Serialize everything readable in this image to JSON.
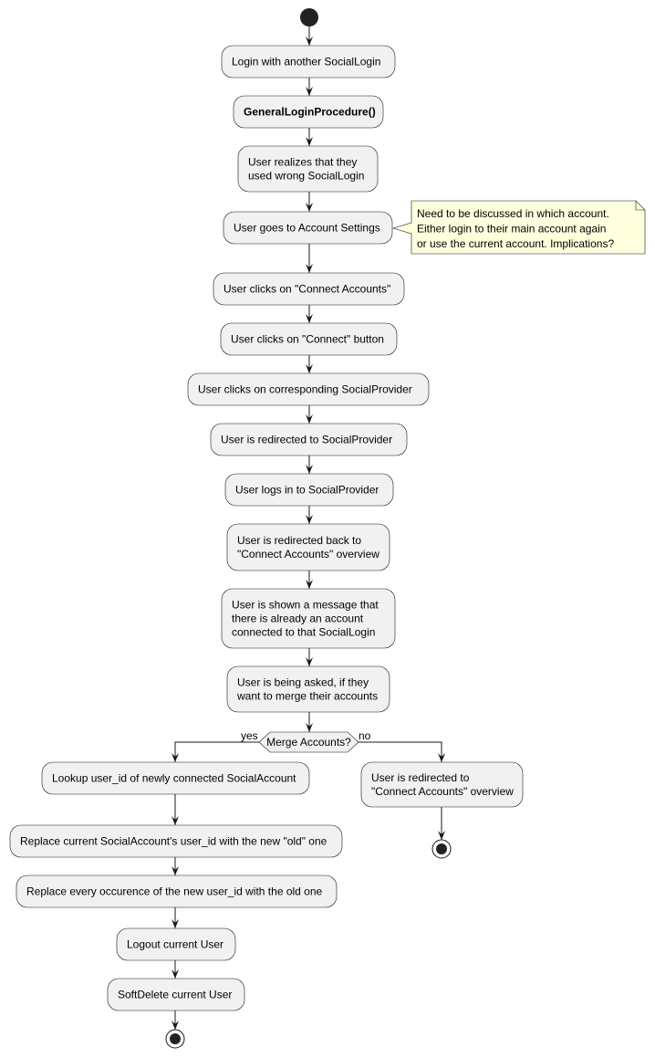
{
  "colors": {
    "node_fill": "#f1f1f1",
    "node_stroke": "#181818",
    "note_fill": "#feffdd",
    "line": "#181818",
    "start": "#222222"
  },
  "nodes": [
    {
      "id": "login-another",
      "lines": [
        "Login with another SocialLogin"
      ]
    },
    {
      "id": "general-login",
      "lines": [
        "GeneralLoginProcedure()"
      ],
      "bold": true
    },
    {
      "id": "realizes-wrong",
      "lines": [
        "User realizes that they",
        "used wrong SocialLogin"
      ]
    },
    {
      "id": "account-settings",
      "lines": [
        "User goes to Account Settings"
      ]
    },
    {
      "id": "click-connect-accounts",
      "lines": [
        "User clicks on \"Connect Accounts\""
      ]
    },
    {
      "id": "click-connect-button",
      "lines": [
        "User clicks on \"Connect\" button"
      ]
    },
    {
      "id": "click-provider",
      "lines": [
        "User clicks on corresponding SocialProvider"
      ]
    },
    {
      "id": "redirected-provider",
      "lines": [
        "User is redirected to SocialProvider"
      ]
    },
    {
      "id": "logs-in-provider",
      "lines": [
        "User logs in to SocialProvider"
      ]
    },
    {
      "id": "redirected-back",
      "lines": [
        "User is redirected back to",
        "\"Connect Accounts\" overview"
      ]
    },
    {
      "id": "shown-message",
      "lines": [
        "User is shown a message that",
        "there is already an account",
        "connected to that SocialLogin"
      ]
    },
    {
      "id": "asked-merge",
      "lines": [
        "User is being asked, if they",
        "want to merge their accounts"
      ]
    },
    {
      "id": "lookup-user-id",
      "lines": [
        "Lookup user_id of newly connected SocialAccount"
      ]
    },
    {
      "id": "replace-current",
      "lines": [
        "Replace current SocialAccount's user_id with the new \"old\" one"
      ]
    },
    {
      "id": "replace-every",
      "lines": [
        "Replace every occurence of the new user_id with the old one"
      ]
    },
    {
      "id": "logout",
      "lines": [
        "Logout current User"
      ]
    },
    {
      "id": "soft-delete",
      "lines": [
        "SoftDelete current User"
      ]
    },
    {
      "id": "redirected-overview",
      "lines": [
        "User is redirected to",
        "\"Connect Accounts\" overview"
      ]
    }
  ],
  "note": {
    "lines": [
      "Need to be discussed in which account.",
      "Either login to their main account again",
      "or use the current account. Implications?"
    ]
  },
  "decision": {
    "label": "Merge Accounts?",
    "yes": "yes",
    "no": "no"
  }
}
